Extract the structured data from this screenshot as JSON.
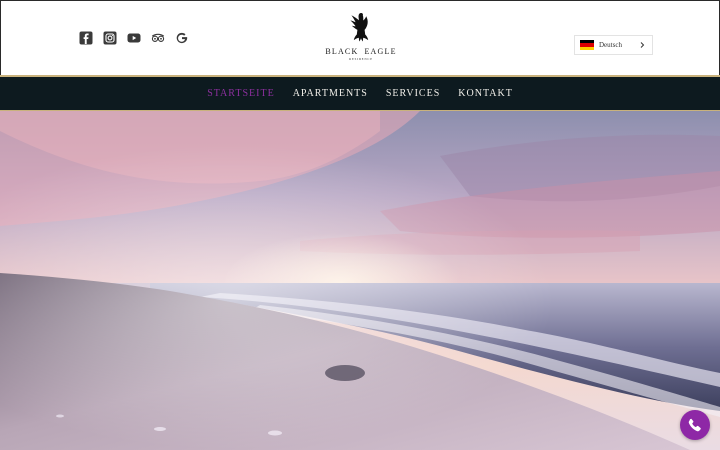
{
  "brand": {
    "name_left": "BLACK",
    "name_right": "EAGLE",
    "subtitle": "RESIDENCE"
  },
  "socials": [
    {
      "icon": "facebook-icon"
    },
    {
      "icon": "instagram-icon"
    },
    {
      "icon": "youtube-icon"
    },
    {
      "icon": "tripadvisor-icon"
    },
    {
      "icon": "google-icon"
    }
  ],
  "language": {
    "label": "Deutsch",
    "flag": "germany-flag-icon"
  },
  "nav": {
    "items": [
      {
        "label": "STARTSEITE",
        "active": true
      },
      {
        "label": "APARTMENTS",
        "active": false
      },
      {
        "label": "SERVICES",
        "active": false
      },
      {
        "label": "KONTAKT",
        "active": false
      }
    ]
  },
  "colors": {
    "nav_background": "#0d1a1f",
    "nav_border": "#c9b27c",
    "nav_active": "#8c2f9e",
    "call_button": "#8e28a6"
  },
  "hero": {
    "image": "beach-sunset-photo"
  },
  "call": {
    "icon": "phone-icon"
  }
}
